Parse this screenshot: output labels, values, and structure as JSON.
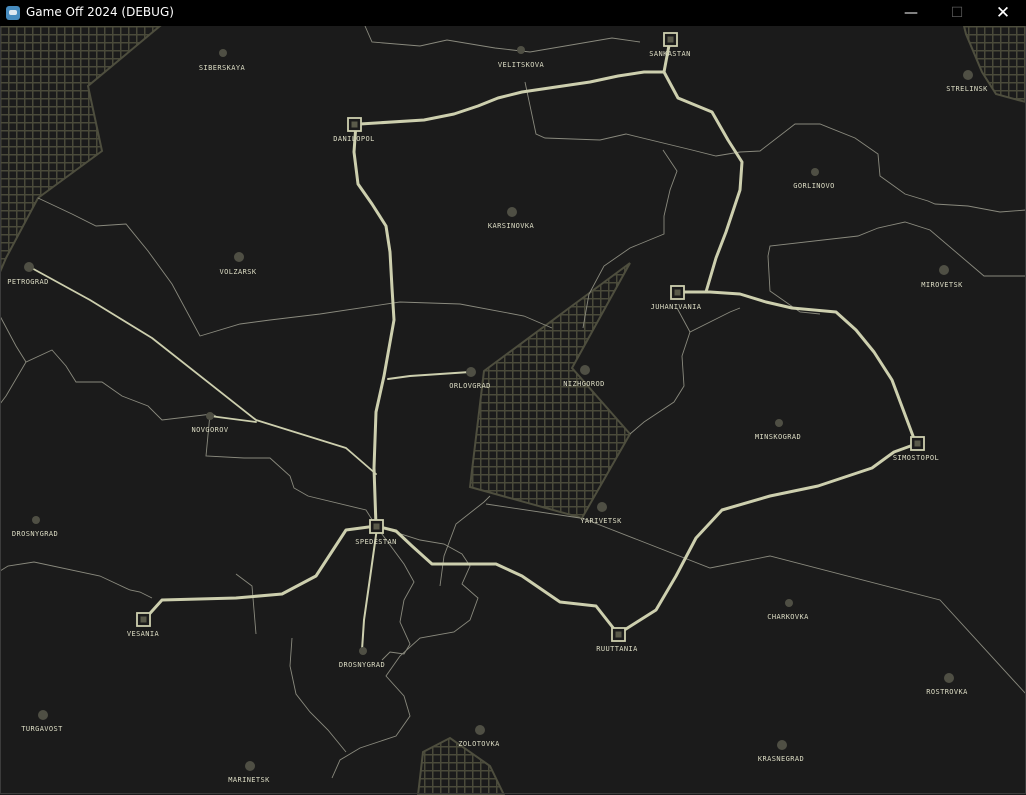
{
  "window": {
    "title": "Game Off 2024 (DEBUG)",
    "minimize_glyph": "—",
    "maximize_glyph": "☐",
    "close_glyph": "✕"
  },
  "colors": {
    "background": "#1b1b1b",
    "border_line": "#8a8a7e",
    "hatch": "#4a4a3a",
    "route": "#cdcfae",
    "station": "#cdcfae",
    "town_dot": "#4f4f44",
    "label": "#dcdcc4"
  },
  "towns": {
    "siberskaya": "SIBERSKAYA",
    "velitskova": "VELITSKOVA",
    "strelinsk": "STRELINSK",
    "gorlinovo": "GORLINOVO",
    "karsinovka": "KARSINOVKA",
    "volzarsk": "VOLZARSK",
    "petrograd": "PETROGRAD",
    "mirovetsk": "MIROVETSK",
    "orlovgrad": "ORLOVGRAD",
    "nizhgorod": "NIZHGOROD",
    "novgorov": "NOVGOROV",
    "minskograd": "MINSKOGRAD",
    "drosnygrad_west": "DROSNYGRAD",
    "yarivetsk": "YARIVETSK",
    "charkovka": "CHARKOVKA",
    "drosnygrad_south": "DROSNYGRAD",
    "rostrovka": "ROSTROVKA",
    "turgavost": "TURGAVOST",
    "zolotovka": "ZOLOTOVKA",
    "krasnegrad": "KRASNEGRAD",
    "marinetsk": "MARINETSK"
  },
  "stations": {
    "sankastan": "SANKASTAN",
    "danilopol": "DANILOPOL",
    "juhanivania": "JUHANIVANIA",
    "simostopol": "SIMOSTOPOL",
    "spedestan": "SPEDESTAN",
    "vesania": "VESANIA",
    "ruuttania": "RUUTTANIA"
  }
}
